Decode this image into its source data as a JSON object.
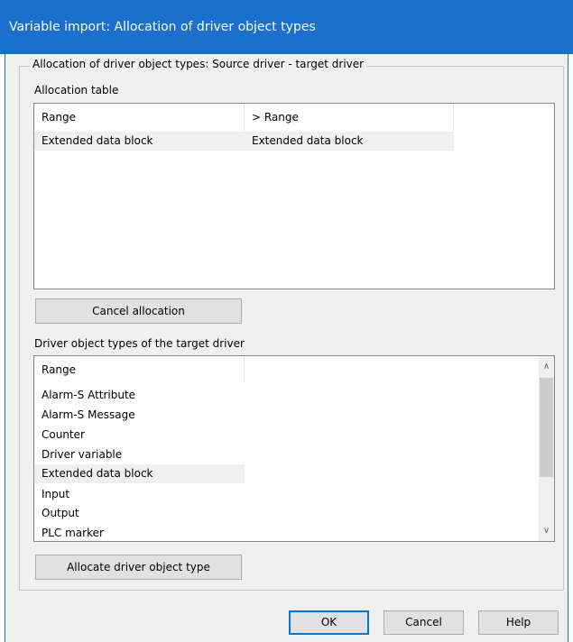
{
  "window": {
    "title": "Variable import: Allocation of driver object types"
  },
  "group": {
    "legend": "Allocation of driver object types: Source driver - target driver"
  },
  "allocation_table": {
    "label": "Allocation table",
    "columns": [
      "Range",
      "> Range"
    ],
    "rows": [
      {
        "source": "Extended data block",
        "target": "Extended data block",
        "selected": true
      }
    ]
  },
  "cancel_allocation_button": "Cancel allocation",
  "target_types": {
    "label": "Driver object types of the target driver",
    "column": "Range",
    "items": [
      {
        "label": "Alarm-S Attribute",
        "selected": false
      },
      {
        "label": "Alarm-S Message",
        "selected": false
      },
      {
        "label": "Counter",
        "selected": false
      },
      {
        "label": "Driver variable",
        "selected": false
      },
      {
        "label": "Extended data block",
        "selected": true
      },
      {
        "label": "Input",
        "selected": false
      },
      {
        "label": "Output",
        "selected": false
      },
      {
        "label": "PLC marker",
        "selected": false
      }
    ]
  },
  "allocate_button": "Allocate driver object type",
  "footer": {
    "ok": "OK",
    "cancel": "Cancel",
    "help": "Help"
  },
  "colors": {
    "titlebar": "#1a6fcf",
    "selection": "#f0f0f0",
    "default_button_border": "#0078d7"
  }
}
